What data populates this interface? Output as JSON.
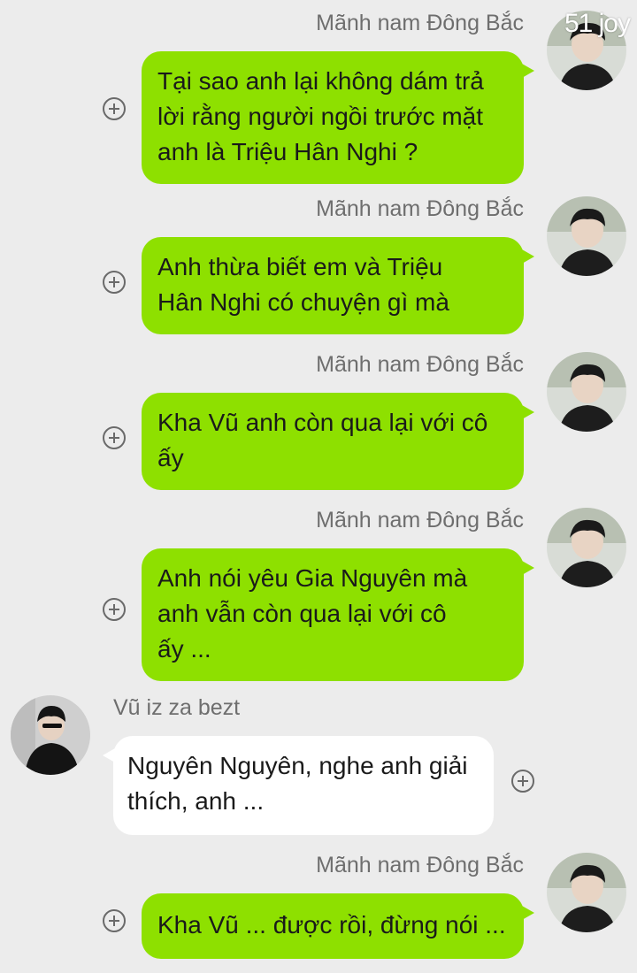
{
  "watermark": "51 joy",
  "messages": [
    {
      "sender": "Mãnh nam Đông Bắc",
      "text": "Tại sao anh lại không dám trả\nlời rằng người ngồi trước mặt\nanh là Triệu Hân Nghi ?",
      "side": "right"
    },
    {
      "sender": "Mãnh nam Đông Bắc",
      "text": "Anh thừa biết em và Triệu\nHân Nghi có chuyện gì mà",
      "side": "right"
    },
    {
      "sender": "Mãnh nam Đông Bắc",
      "text": "Kha Vũ anh còn qua lại với cô\nấy",
      "side": "right"
    },
    {
      "sender": "Mãnh nam Đông Bắc",
      "text": "Anh nói yêu Gia Nguyên mà\nanh vẫn còn qua lại với cô\nấy ...",
      "side": "right"
    },
    {
      "sender": "Vũ iz za bezt",
      "text": "Nguyên Nguyên, nghe anh giải\nthích, anh ...",
      "side": "left"
    },
    {
      "sender": "Mãnh nam Đông Bắc",
      "text": "Kha Vũ ... được rồi, đừng nói ...",
      "side": "right"
    }
  ],
  "colors": {
    "background": "#ececec",
    "own_bubble": "#8ee000",
    "other_bubble": "#ffffff",
    "sender_text": "#6e6e6e"
  },
  "icons": {
    "add": "plus-circle-icon",
    "avatar_right": "user-avatar-dark-hair",
    "avatar_left": "user-avatar-black-jacket"
  }
}
